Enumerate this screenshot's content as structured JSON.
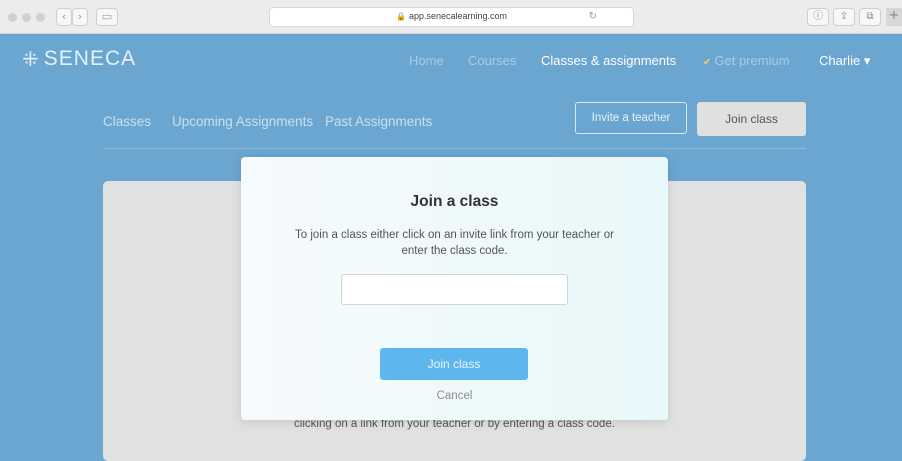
{
  "browser": {
    "url": "app.senecalearning.com",
    "lock_glyph": "🔒",
    "reload_glyph": "↻",
    "back_glyph": "‹",
    "forward_glyph": "›",
    "sidebar_glyph": "▭",
    "info_glyph": "ⓘ",
    "share_glyph": "⇪",
    "tabs_glyph": "⧉",
    "newtab_glyph": "+"
  },
  "header": {
    "logo_mark": "⁜",
    "logo_text": "SENECA",
    "nav": [
      {
        "label": "Home"
      },
      {
        "label": "Courses"
      },
      {
        "label": "Classes & assignments"
      },
      {
        "label": "Get premium",
        "icon": "✔"
      }
    ],
    "user": "Charlie",
    "user_caret": "▾"
  },
  "subnav": {
    "tabs": [
      {
        "label": "Classes"
      },
      {
        "label": "Upcoming Assignments"
      },
      {
        "label": "Past Assignments"
      }
    ],
    "invite_button": "Invite a teacher",
    "join_button": "Join class"
  },
  "background_card": {
    "text": "clicking on a link from your teacher or by entering a class code."
  },
  "modal": {
    "title": "Join a class",
    "description": "To join a class either click on an invite link from your teacher or enter the class code.",
    "input_value": "",
    "join_button": "Join class",
    "cancel": "Cancel"
  },
  "colors": {
    "brand_blue": "#6aa6cf",
    "button_blue": "#5db6ec",
    "card_grey": "#e1e1e1"
  }
}
